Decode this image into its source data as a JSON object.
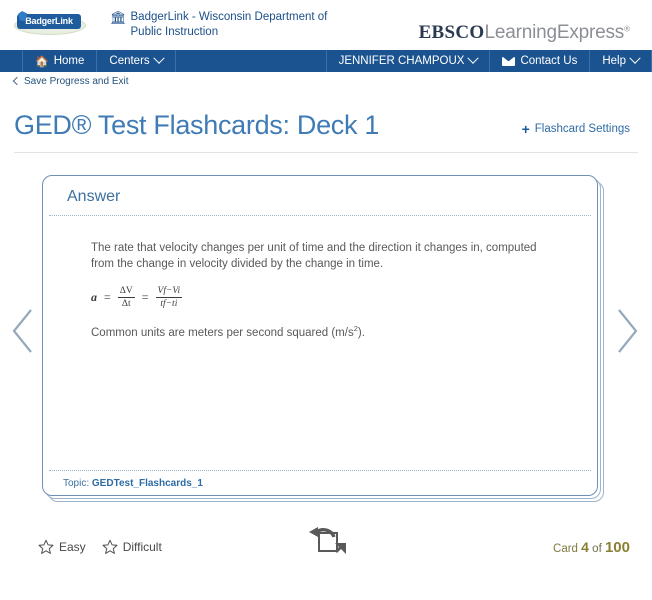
{
  "header": {
    "logo_text": "BadgerLink",
    "institution": "BadgerLink - Wisconsin Department of Public Instruction",
    "institution_icon": "bank-icon",
    "product_brand_bold": "EBSCO",
    "product_brand_light": "LearningExpress",
    "product_brand_mark": "®"
  },
  "nav": {
    "home": "Home",
    "centers": "Centers",
    "user": "JENNIFER CHAMPOUX",
    "contact": "Contact Us",
    "help": "Help"
  },
  "breadcrumb": {
    "save_exit": "Save Progress and Exit"
  },
  "page": {
    "title": "GED® Test Flashcards: Deck 1",
    "settings_link": "Flashcard Settings",
    "settings_plus": "+"
  },
  "flashcard": {
    "side_label": "Answer",
    "paragraph1": "The rate that velocity changes per unit of time and the direction it changes in, computed from the change in velocity divided by the change in time.",
    "formula": {
      "lhs": "a",
      "eq1": "=",
      "frac1_num": "ΔV",
      "frac1_den": "Δt",
      "eq2": "=",
      "frac2_num": "Vf−Vi",
      "frac2_den": "tf−ti",
      "plain": "a = ΔV/Δt = (Vf − Vi)/(tf − ti)"
    },
    "paragraph2_pre": "Common units are meters per second squared (m/s",
    "paragraph2_sup": "2",
    "paragraph2_post": ").",
    "topic_label": "Topic:",
    "topic_value": "GEDTest_Flashcards_1"
  },
  "controls": {
    "easy_label": "Easy",
    "difficult_label": "Difficult",
    "flip_icon": "flip-card-icon",
    "prev_icon": "chevron-left-icon",
    "next_icon": "chevron-right-icon",
    "counter_prefix": "Card",
    "counter_current": "4",
    "counter_of": "of",
    "counter_total": "100"
  },
  "colors": {
    "nav_blue": "#1b5390",
    "title_blue": "#3f7bb5",
    "link_blue": "#2e6ca4",
    "counter_olive": "#8a8033",
    "card_border": "#6e91b5"
  }
}
